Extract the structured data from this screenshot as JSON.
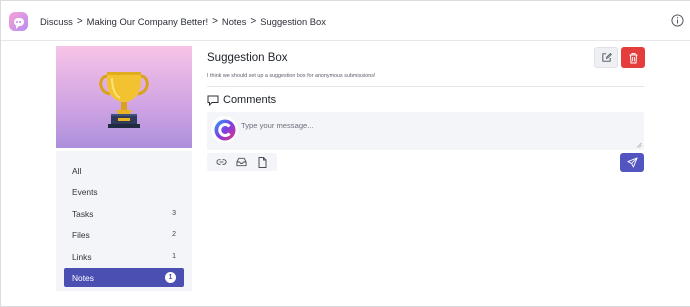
{
  "breadcrumb": {
    "items": [
      "Discuss",
      "Making Our Company Better!",
      "Notes",
      "Suggestion Box"
    ],
    "separator": ">"
  },
  "sidebar": {
    "items": [
      {
        "label": "All",
        "count": ""
      },
      {
        "label": "Events",
        "count": ""
      },
      {
        "label": "Tasks",
        "count": "3"
      },
      {
        "label": "Files",
        "count": "2"
      },
      {
        "label": "Links",
        "count": "1"
      },
      {
        "label": "Notes",
        "count": "1",
        "active": true
      }
    ]
  },
  "note": {
    "title": "Suggestion Box",
    "description": "I think we should set up a suggestion box for anonymous submissions!"
  },
  "comments": {
    "heading": "Comments",
    "placeholder": "Type your message..."
  },
  "colors": {
    "accent": "#4b4fb2",
    "danger": "#e53c3c",
    "panel": "#f4f5f8"
  },
  "icons": {
    "header": [
      "app-logo",
      "info-icon"
    ],
    "note_actions": [
      "edit-icon",
      "trash-icon"
    ],
    "composer_tools": [
      "link-icon",
      "inbox-icon",
      "file-icon"
    ],
    "send": "send-icon"
  }
}
